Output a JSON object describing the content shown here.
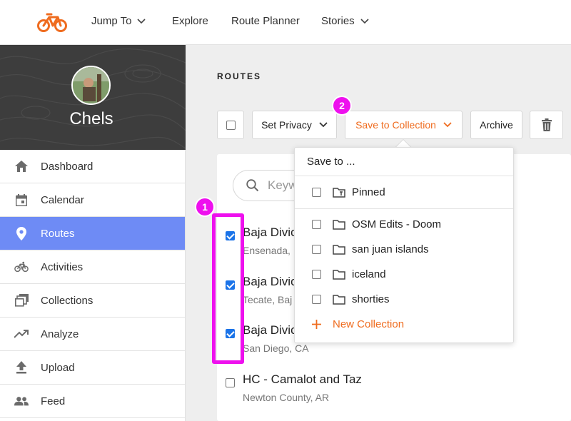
{
  "topnav": {
    "items": [
      {
        "label": "Jump To",
        "dropdown": true
      },
      {
        "label": "Explore",
        "dropdown": false
      },
      {
        "label": "Route Planner",
        "dropdown": false
      },
      {
        "label": "Stories",
        "dropdown": true
      }
    ]
  },
  "profile": {
    "name": "Chels"
  },
  "sidebar": {
    "items": [
      {
        "label": "Dashboard",
        "icon": "home-icon"
      },
      {
        "label": "Calendar",
        "icon": "calendar-icon"
      },
      {
        "label": "Routes",
        "icon": "location-pin-icon",
        "active": true
      },
      {
        "label": "Activities",
        "icon": "bicycle-icon"
      },
      {
        "label": "Collections",
        "icon": "collections-icon"
      },
      {
        "label": "Analyze",
        "icon": "trending-up-icon"
      },
      {
        "label": "Upload",
        "icon": "upload-icon"
      },
      {
        "label": "Feed",
        "icon": "people-icon"
      }
    ]
  },
  "main": {
    "title": "ROUTES",
    "toolbar": {
      "privacy_label": "Set Privacy",
      "save_label": "Save to Collection",
      "archive_label": "Archive"
    },
    "search": {
      "placeholder": "Keyw"
    },
    "routes": [
      {
        "title": "Baja Divic",
        "subtitle": "Ensenada,",
        "checked": true
      },
      {
        "title": "Baja Divic",
        "subtitle": "Tecate, Baj",
        "checked": true
      },
      {
        "title": "Baja Divic",
        "subtitle": "San Diego, CA",
        "checked": true
      },
      {
        "title": "HC - Camalot and Taz",
        "subtitle": "Newton County, AR",
        "checked": false
      }
    ]
  },
  "dropdown": {
    "header": "Save to ...",
    "pinned": "Pinned",
    "collections": [
      "OSM Edits - Doom",
      "san juan islands",
      "iceland",
      "shorties"
    ],
    "new_collection": "New Collection"
  },
  "annotations": {
    "badge1": "1",
    "badge2": "2"
  },
  "colors": {
    "accent": "#ef6c1f",
    "active": "#6e8bf5",
    "highlight": "#ee10ee",
    "checkbox": "#1a73e8"
  }
}
